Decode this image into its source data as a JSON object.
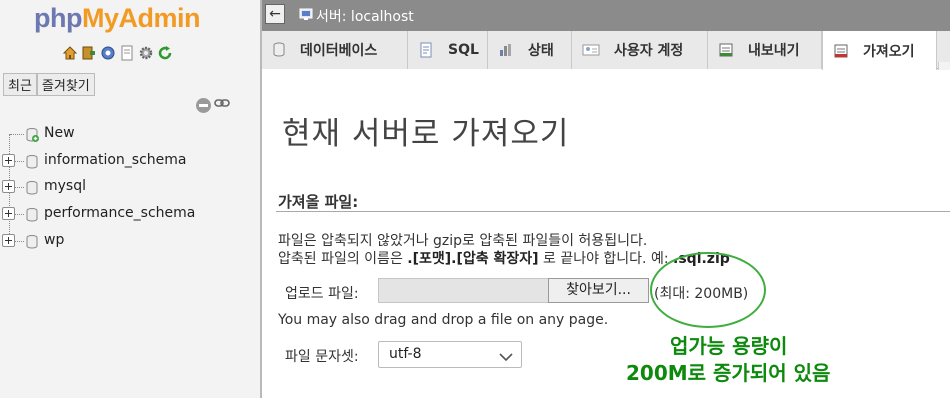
{
  "nav": {
    "logo_php": "php",
    "logo_myadmin": "MyAdmin",
    "icons": [
      "home-icon",
      "exit-icon",
      "query-icon",
      "docs-icon",
      "settings-icon",
      "reload-icon"
    ],
    "tab_recent": "최근",
    "tab_favorites": "즐겨찾기",
    "tree": {
      "new_label": "New",
      "databases": [
        "information_schema",
        "mysql",
        "performance_schema",
        "wp"
      ]
    }
  },
  "topbar": {
    "server_label": "서버: localhost"
  },
  "tabs": [
    {
      "label": "데이터베이스",
      "icon": "database-icon"
    },
    {
      "label": "SQL",
      "icon": "sql-icon"
    },
    {
      "label": "상태",
      "icon": "status-icon"
    },
    {
      "label": "사용자 계정",
      "icon": "user-accounts-icon"
    },
    {
      "label": "내보내기",
      "icon": "export-icon"
    },
    {
      "label": "가져오기",
      "icon": "import-icon",
      "active": true
    }
  ],
  "main": {
    "title": "현재 서버로 가져오기",
    "section_title": "가져올 파일:",
    "info_line1": "파일은 압축되지 않았거나 gzip로 압축된 파일들이 허용됩니다.",
    "info_line2_prefix": "압축된 파일의 이름은 ",
    "info_line2_format": ".[포맷].[압축 확장자]",
    "info_line2_mid": " 로 끝나야 합니다. 예: ",
    "info_line2_example": ".sql.zip",
    "upload_label": "업로드 파일:",
    "browse_button": "찾아보기...",
    "max_size": "(최대: 200MB)",
    "drag_hint": "You may also drag and drop a file on any page.",
    "charset_label": "파일 문자셋:",
    "charset_value": "utf-8"
  },
  "annotation": {
    "line1": "업가능 용량이",
    "line2": "200M로 증가되어 있음",
    "color": "#0d8a0d"
  }
}
